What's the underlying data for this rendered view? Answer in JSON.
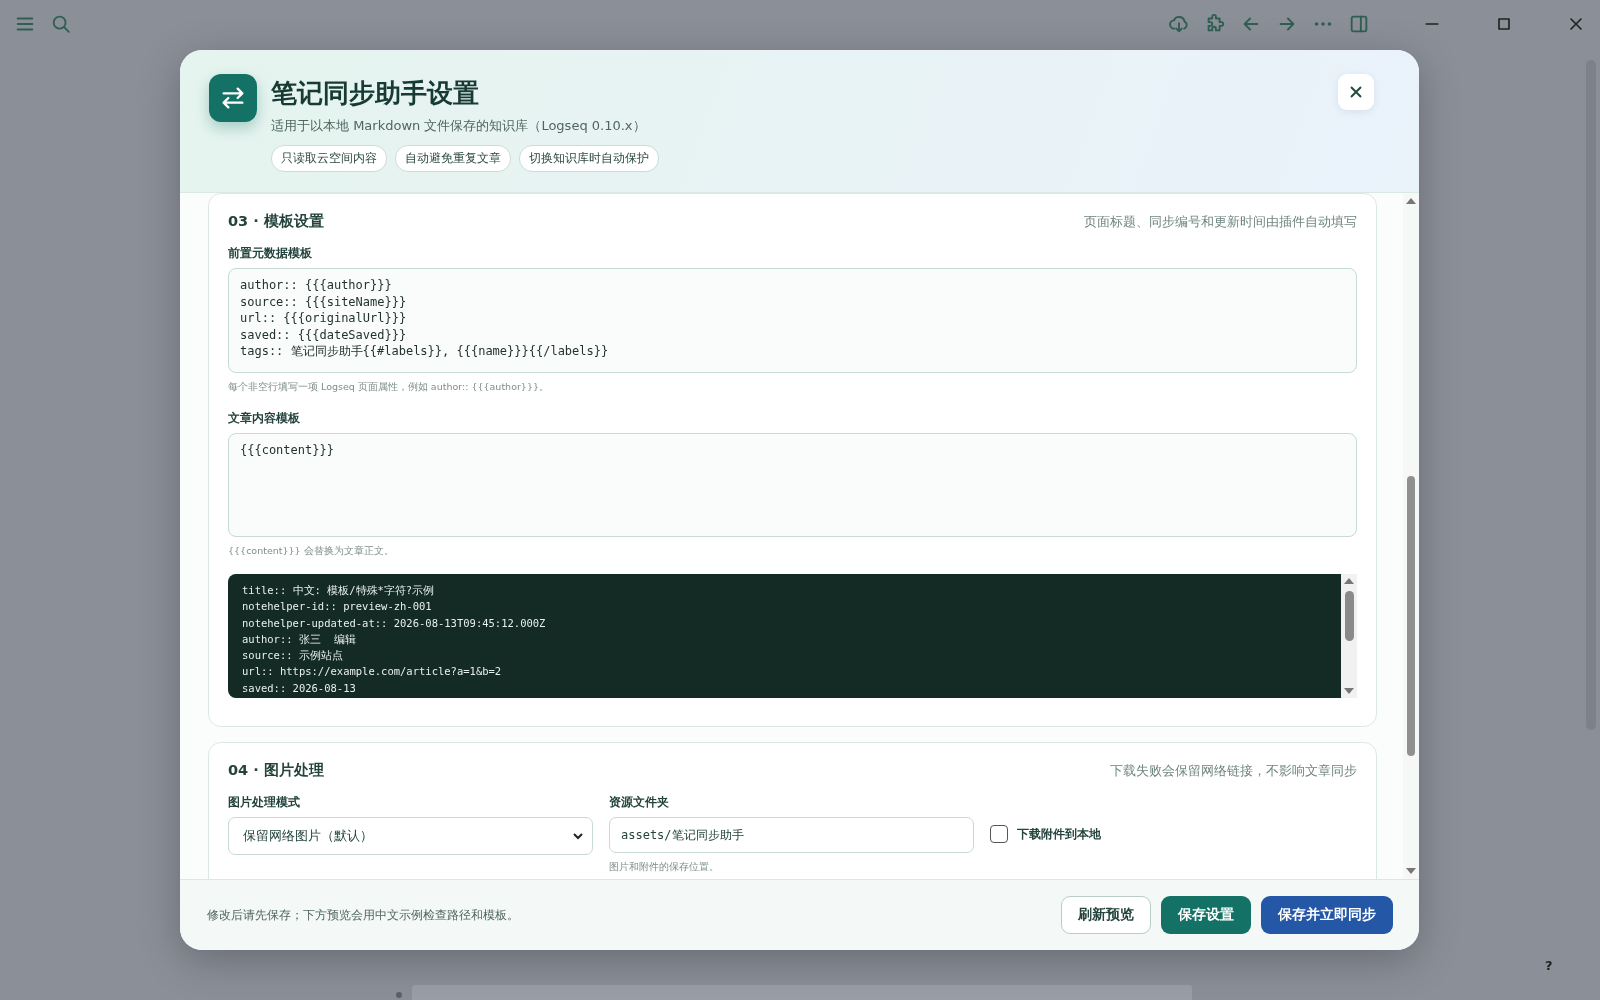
{
  "background_page": {
    "help": "?"
  },
  "dialog": {
    "title": "笔记同步助手设置",
    "subtitle": "适用于以本地 Markdown 文件保存的知识库（Logseq 0.10.x）",
    "chips": [
      "只读取云空间内容",
      "自动避免重复文章",
      "切换知识库时自动保护"
    ],
    "sections": [
      {
        "kind": "templates",
        "heading": "03 · 模板设置",
        "note": "页面标题、同步编号和更新时间由插件自动填写",
        "fields": [
          {
            "label": "前置元数据模板",
            "value": "author:: {{{author}}}\nsource:: {{{siteName}}}\nurl:: {{{originalUrl}}}\nsaved:: {{{dateSaved}}}\ntags:: 笔记同步助手{{#labels}}, {{{name}}}{{/labels}}",
            "hint": "每个非空行填写一项 Logseq 页面属性，例如 author:: {{{author}}}。"
          },
          {
            "label": "文章内容模板",
            "value": "{{{content}}}",
            "hint": "{{{content}}} 会替换为文章正文。"
          }
        ],
        "preview": [
          "title:: 中文: 模板/特殊*字符?示例",
          "notehelper-id:: preview-zh-001",
          "notehelper-updated-at:: 2026-08-13T09:45:12.000Z",
          "author:: 张三  编辑",
          "source:: 示例站点",
          "url:: https://example.com/article?a=1&b=2",
          "saved:: 2026-08-13"
        ]
      },
      {
        "kind": "images",
        "heading": "04 · 图片处理",
        "note": "下载失败会保留网络链接，不影响文章同步",
        "mode": {
          "label": "图片处理模式",
          "value": "保留网络图片（默认）"
        },
        "folder": {
          "label": "资源文件夹",
          "value": "assets/笔记同步助手",
          "hint": "图片和附件的保存位置。"
        },
        "download": {
          "label": "下载附件到本地",
          "checked": false
        }
      }
    ],
    "footer": {
      "note": "修改后请先保存；下方预览会用中文示例检查路径和模板。",
      "buttons": [
        {
          "label": "刷新预览",
          "kind": "outline"
        },
        {
          "label": "保存设置",
          "kind": "green"
        },
        {
          "label": "保存并立即同步",
          "kind": "blue"
        }
      ]
    }
  }
}
